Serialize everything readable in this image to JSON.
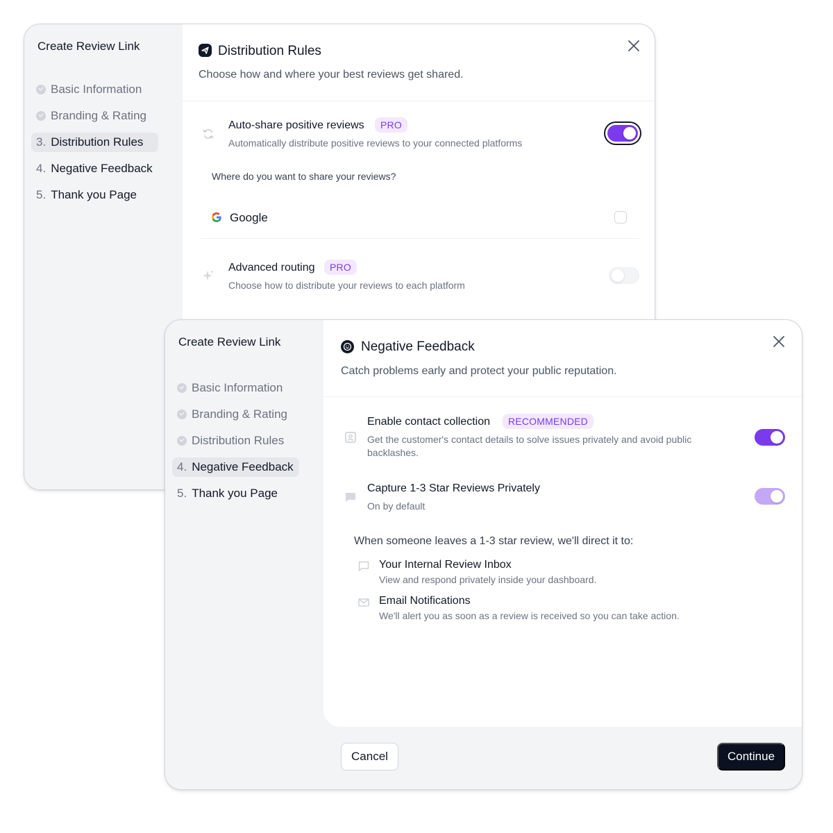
{
  "back_modal": {
    "sidebar": {
      "title": "Create Review Link",
      "steps": [
        {
          "num": "",
          "label": "Basic Information",
          "state": "done"
        },
        {
          "num": "",
          "label": "Branding & Rating",
          "state": "done"
        },
        {
          "num": "3.",
          "label": "Distribution Rules",
          "state": "active"
        },
        {
          "num": "4.",
          "label": "Negative Feedback",
          "state": "todo"
        },
        {
          "num": "5.",
          "label": "Thank you Page",
          "state": "todo"
        }
      ]
    },
    "header": {
      "icon": "send-icon",
      "title": "Distribution Rules",
      "subtitle": "Choose how and where your best reviews get shared."
    },
    "auto_share": {
      "icon": "refresh-icon",
      "title": "Auto-share positive reviews",
      "badge": "PRO",
      "description": "Automatically distribute positive reviews to your connected platforms",
      "enabled": true
    },
    "share_question": "Where do you want to share your reviews?",
    "platforms": [
      {
        "icon": "google-icon",
        "name": "Google",
        "checked": false
      }
    ],
    "advanced_routing": {
      "icon": "sparkle-icon",
      "title": "Advanced routing",
      "badge": "PRO",
      "description": "Choose how to distribute your reviews to each platform",
      "enabled": false
    }
  },
  "front_modal": {
    "sidebar": {
      "title": "Create Review Link",
      "steps": [
        {
          "num": "",
          "label": "Basic Information",
          "state": "done"
        },
        {
          "num": "",
          "label": "Branding & Rating",
          "state": "done"
        },
        {
          "num": "",
          "label": "Distribution Rules",
          "state": "done"
        },
        {
          "num": "4.",
          "label": "Negative Feedback",
          "state": "active"
        },
        {
          "num": "5.",
          "label": "Thank you Page",
          "state": "todo"
        }
      ]
    },
    "header": {
      "icon": "smile-icon",
      "title": "Negative Feedback",
      "subtitle": "Catch problems early and protect your public reputation."
    },
    "contact_collection": {
      "icon": "contact-card-icon",
      "title": "Enable contact collection",
      "badge": "RECOMMENDED",
      "description": "Get the customer's contact details to solve issues privately and avoid public backlashes.",
      "enabled": true
    },
    "capture_private": {
      "icon": "chat-bubble-icon",
      "title": "Capture 1-3 Star Reviews Privately",
      "description": "On by default",
      "enabled": true
    },
    "direct_heading": "When someone leaves a 1-3 star review, we'll direct it to:",
    "destinations": [
      {
        "icon": "message-icon",
        "title": "Your Internal Review Inbox",
        "description": "View and respond privately inside your dashboard."
      },
      {
        "icon": "mail-icon",
        "title": "Email Notifications",
        "description": "We'll alert you as soon as a review is received so you can take action."
      }
    ],
    "footer": {
      "cancel_label": "Cancel",
      "continue_label": "Continue"
    }
  },
  "colors": {
    "accent": "#7c3aed",
    "accent_light": "#c4a8f5",
    "badge_bg": "#f3e8ff",
    "primary_button": "#0b1120",
    "sidebar_bg": "#f3f4f6"
  }
}
